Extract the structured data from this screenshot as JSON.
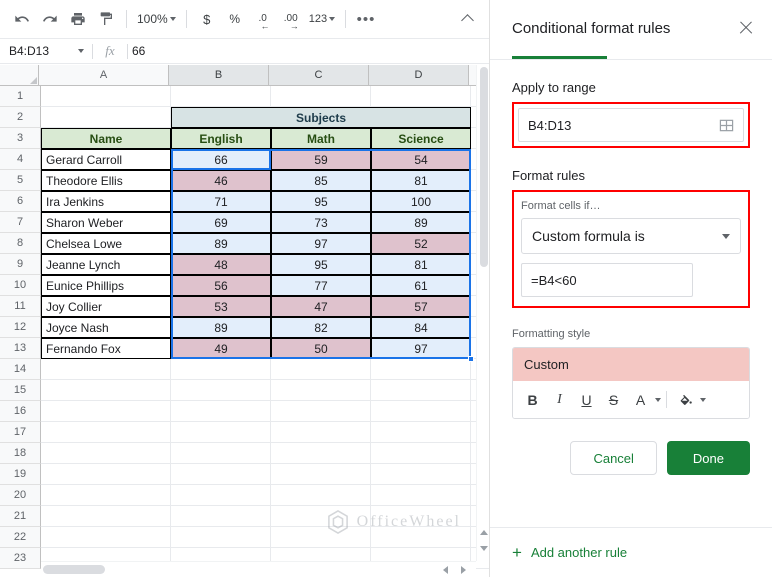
{
  "toolbar": {
    "undo_label": "undo-icon",
    "redo_label": "redo-icon",
    "print_label": "print-icon",
    "paint_label": "paint-format-icon",
    "zoom_value": "100%",
    "currency_label": "$",
    "percent_label": "%",
    "dec_decrease_label": ".0",
    "dec_increase_label": ".00",
    "number_format_label": "123",
    "more_label": "•••"
  },
  "formula_bar": {
    "name_box_value": "B4:D13",
    "fx_label": "fx",
    "content": "66"
  },
  "grid": {
    "columns": [
      "A",
      "B",
      "C",
      "D"
    ],
    "row_numbers": [
      "1",
      "2",
      "3",
      "4",
      "5",
      "6",
      "7",
      "8",
      "9",
      "10",
      "11",
      "12",
      "13",
      "14",
      "15",
      "16",
      "17",
      "18",
      "19",
      "20",
      "21",
      "22",
      "23"
    ],
    "merged_header": "Subjects",
    "headers": [
      "Name",
      "English",
      "Math",
      "Science"
    ],
    "rows": [
      {
        "name": "Gerard Carroll",
        "english": "66",
        "math": "59",
        "science": "54"
      },
      {
        "name": "Theodore Ellis",
        "english": "46",
        "math": "85",
        "science": "81"
      },
      {
        "name": "Ira Jenkins",
        "english": "71",
        "math": "95",
        "science": "100"
      },
      {
        "name": "Sharon Weber",
        "english": "69",
        "math": "73",
        "science": "89"
      },
      {
        "name": "Chelsea Lowe",
        "english": "89",
        "math": "97",
        "science": "52"
      },
      {
        "name": "Jeanne Lynch",
        "english": "48",
        "math": "95",
        "science": "81"
      },
      {
        "name": "Eunice Phillips",
        "english": "56",
        "math": "77",
        "science": "61"
      },
      {
        "name": "Joy Collier",
        "english": "53",
        "math": "47",
        "science": "57"
      },
      {
        "name": "Joyce Nash",
        "english": "89",
        "math": "82",
        "science": "84"
      },
      {
        "name": "Fernando Fox",
        "english": "49",
        "math": "50",
        "science": "97"
      }
    ],
    "watermark": "OfficeWheel"
  },
  "panel": {
    "title": "Conditional format rules",
    "close_label": "close-icon",
    "apply_to_range_label": "Apply to range",
    "range_value": "B4:D13",
    "format_rules_label": "Format rules",
    "format_cells_if_label": "Format cells if…",
    "condition_value": "Custom formula is",
    "formula_value": "=B4<60",
    "formatting_style_label": "Formatting style",
    "style_preview_text": "Custom",
    "style_tools": {
      "bold": "B",
      "italic": "I",
      "underline": "U",
      "strikethrough": "S",
      "text_color": "A"
    },
    "cancel_label": "Cancel",
    "done_label": "Done",
    "add_rule_label": "Add another rule",
    "add_rule_plus": "+"
  },
  "colors": {
    "accent_green": "#188038",
    "annotation_red": "#ff0000",
    "highlight_pink": "#dfc2cd",
    "selection_blue": "#e3eefb",
    "style_pink": "#f4c7c3",
    "header_green": "#d9ead3",
    "subjects_blue": "#d7e3e4"
  }
}
